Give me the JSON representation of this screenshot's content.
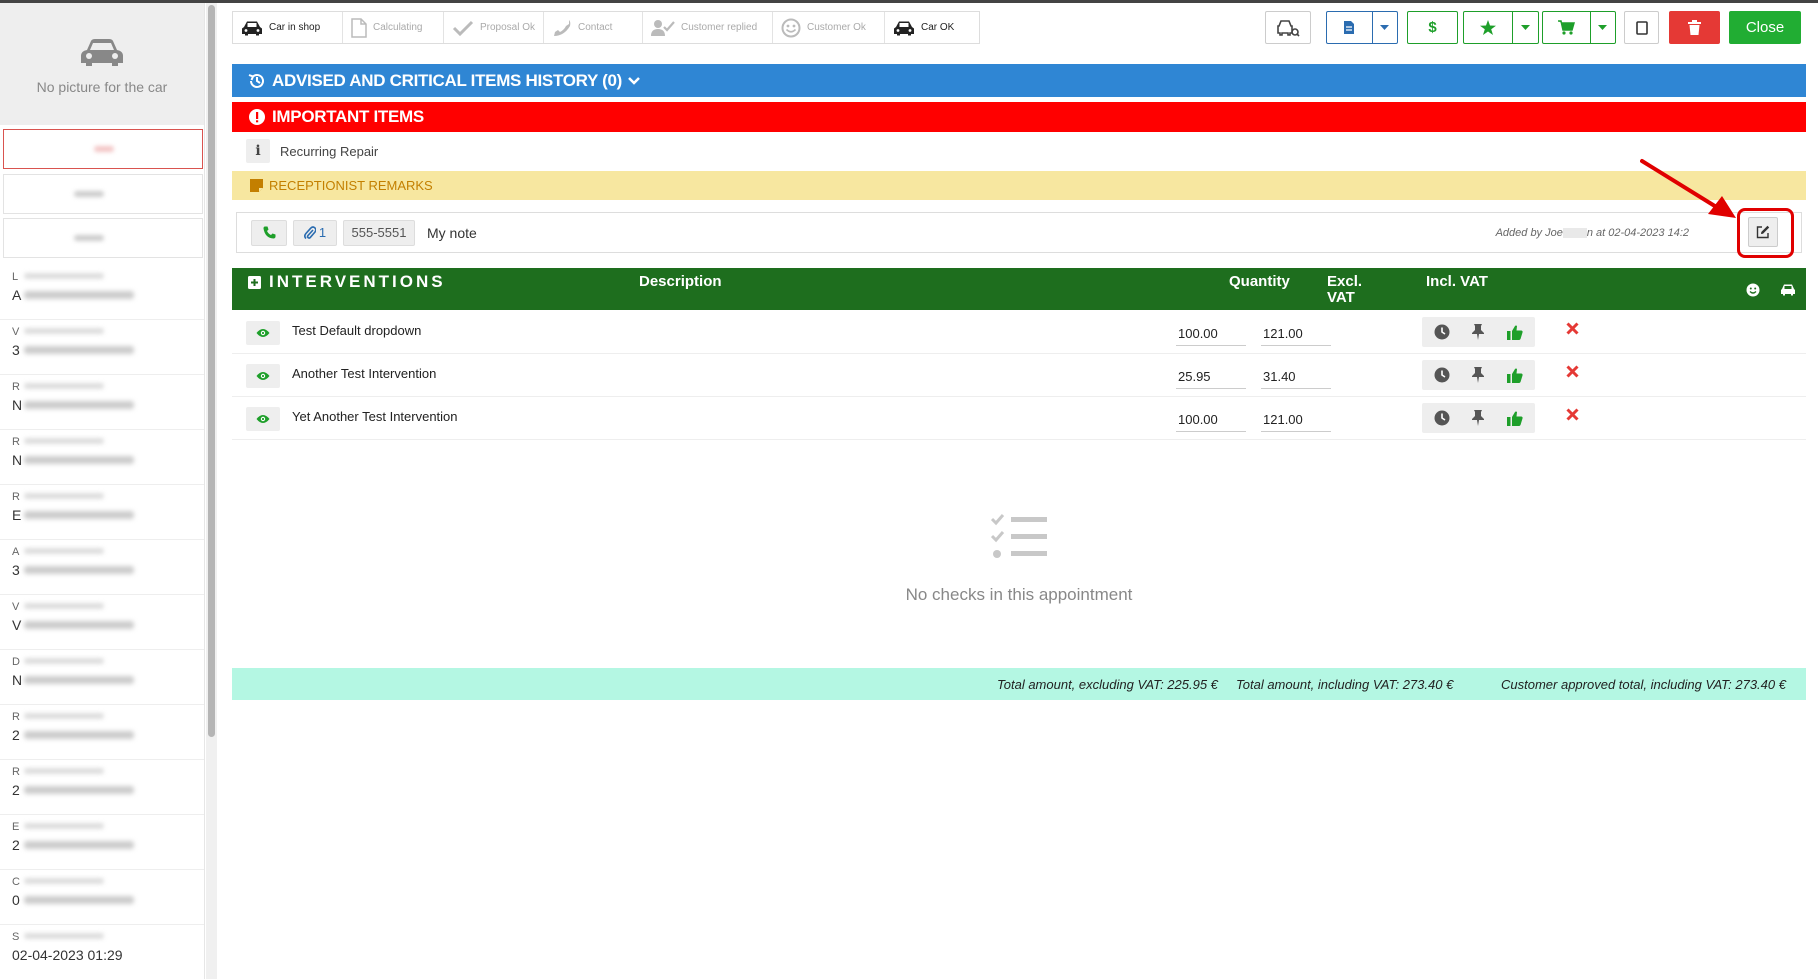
{
  "sidebar": {
    "no_picture": "No picture for the car",
    "fields": [
      {
        "letter": "L"
      },
      {
        "letter": "A"
      },
      {
        "letter": "V"
      },
      {
        "letter": "3"
      },
      {
        "letter": "R"
      },
      {
        "letter": "N"
      },
      {
        "letter": "R"
      },
      {
        "letter": "N"
      },
      {
        "letter": "R"
      },
      {
        "letter": "E"
      },
      {
        "letter": "A"
      },
      {
        "letter": "3"
      },
      {
        "letter": "V"
      },
      {
        "letter": "V"
      },
      {
        "letter": "D"
      },
      {
        "letter": "N"
      },
      {
        "letter": "R"
      },
      {
        "letter": "2"
      },
      {
        "letter": "R"
      },
      {
        "letter": "2"
      },
      {
        "letter": "E"
      },
      {
        "letter": "2"
      },
      {
        "letter": "C"
      },
      {
        "letter": "0"
      },
      {
        "letter": "S"
      },
      {
        "letter": "02-04-2023 01:29"
      }
    ]
  },
  "steps": [
    {
      "label": "Car in shop",
      "active": true
    },
    {
      "label": "Calculating",
      "active": false
    },
    {
      "label": "Proposal Ok",
      "active": false
    },
    {
      "label": "Contact",
      "active": false
    },
    {
      "label": "Customer replied",
      "active": false
    },
    {
      "label": "Customer Ok",
      "active": false
    },
    {
      "label": "Car OK",
      "active": true
    }
  ],
  "toolbar": {
    "close_label": "Close",
    "dollar": "$"
  },
  "advised": {
    "title": "ADVISED AND CRITICAL ITEMS HISTORY (0)"
  },
  "important": {
    "title": "IMPORTANT ITEMS",
    "item": "Recurring Repair",
    "info": "i"
  },
  "remarks": {
    "title": "RECEPTIONIST REMARKS",
    "attach_count": "1",
    "phone": "555-5551",
    "note": "My note",
    "added_prefix": "Added by Joe",
    "added_suffix": "n at 02-04-2023 14:2"
  },
  "interventions": {
    "title": "INTERVENTIONS",
    "col_description": "Description",
    "col_quantity": "Quantity",
    "col_excl_1": "Excl.",
    "col_excl_2": "VAT",
    "col_incl": "Incl. VAT",
    "rows": [
      {
        "name": "Test Default dropdown",
        "excl": "100.00",
        "incl": "121.00"
      },
      {
        "name": "Another Test Intervention",
        "excl": "25.95",
        "incl": "31.40"
      },
      {
        "name": "Yet Another Test Intervention",
        "excl": "100.00",
        "incl": "121.00"
      }
    ]
  },
  "checks": {
    "empty": "No checks in this appointment"
  },
  "totals": {
    "excl": "Total amount, excluding VAT: 225.95 €",
    "incl": "Total amount, including VAT: 273.40 €",
    "approved": "Customer approved total, including VAT: 273.40 €"
  },
  "colors": {
    "blue": "#2f86d4",
    "red": "#ff0000",
    "green": "#1e6e1e",
    "yellow": "#f7e7a0",
    "mint": "#b4f7e3",
    "accent_red": "#e00000"
  }
}
